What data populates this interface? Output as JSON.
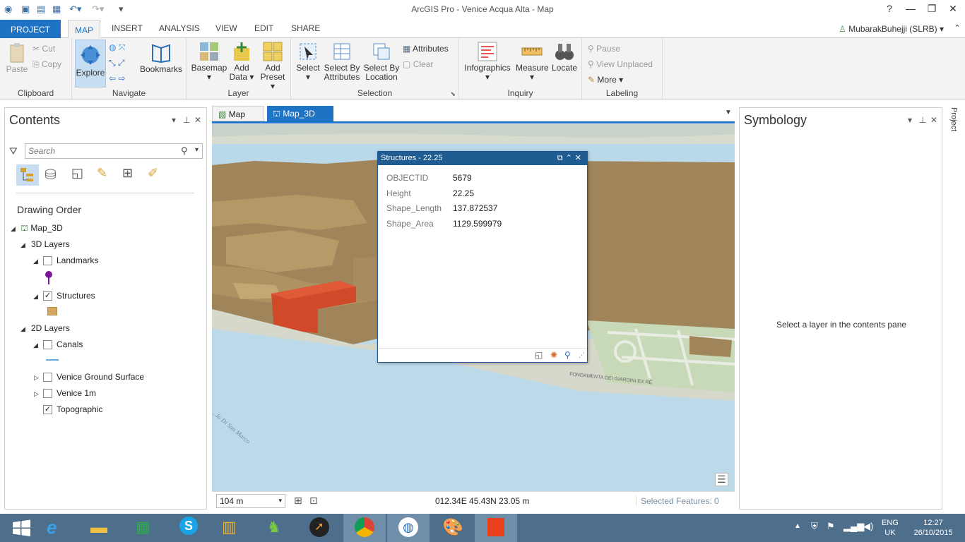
{
  "window": {
    "title": "ArcGIS Pro - Venice Acqua Alta - Map"
  },
  "tabs": [
    "PROJECT",
    "MAP",
    "INSERT",
    "ANALYSIS",
    "VIEW",
    "EDIT",
    "SHARE"
  ],
  "user": {
    "name": "MubarakBuhejji (SLRB)"
  },
  "ribbon": {
    "clipboard": {
      "label": "Clipboard",
      "paste": "Paste",
      "cut": "Cut",
      "copy": "Copy"
    },
    "navigate": {
      "label": "Navigate",
      "explore": "Explore",
      "bookmarks": "Bookmarks"
    },
    "layer": {
      "label": "Layer",
      "basemap": "Basemap",
      "add_data_1": "Add",
      "add_data_2": "Data",
      "add_preset_1": "Add",
      "add_preset_2": "Preset"
    },
    "selection": {
      "label": "Selection",
      "select": "Select",
      "select_by_attr_1": "Select By",
      "select_by_attr_2": "Attributes",
      "select_by_loc_1": "Select By",
      "select_by_loc_2": "Location",
      "attributes": "Attributes",
      "clear": "Clear"
    },
    "inquiry": {
      "label": "Inquiry",
      "infographics": "Infographics",
      "measure": "Measure",
      "locate": "Locate"
    },
    "labeling": {
      "label": "Labeling",
      "pause": "Pause",
      "view_unplaced": "View Unplaced",
      "more": "More"
    }
  },
  "contents": {
    "title": "Contents",
    "search_placeholder": "Search",
    "drawing_order": "Drawing Order",
    "map_name": "Map_3D",
    "group_3d": "3D Layers",
    "landmarks": "Landmarks",
    "structures": "Structures",
    "group_2d": "2D Layers",
    "canals": "Canals",
    "venice_ground": "Venice Ground Surface",
    "venice_1m": "Venice 1m",
    "topographic": "Topographic"
  },
  "views": {
    "map_tab": "Map",
    "map3d_tab": "Map_3D"
  },
  "popup": {
    "title": "Structures - 22.25",
    "fields": [
      {
        "key": "OBJECTID",
        "value": "5679"
      },
      {
        "key": "Height",
        "value": "22.25"
      },
      {
        "key": "Shape_Length",
        "value": "137.872537"
      },
      {
        "key": "Shape_Area",
        "value": "1129.599979"
      }
    ]
  },
  "status": {
    "scale": "104 m",
    "coords": "012.34E 45.43N   23.05 m",
    "selected": "Selected Features: 0"
  },
  "symbology": {
    "title": "Symbology",
    "message": "Select a layer in the contents pane"
  },
  "side_tab": "Project",
  "map_labels": {
    "street_label": "FONDAMENTA DEI GIARDINI EX RE",
    "water_label": "...lo Di San Marco"
  },
  "tray": {
    "lang_1": "ENG",
    "lang_2": "UK",
    "time": "12:27",
    "date": "26/10/2015"
  },
  "colors": {
    "accent": "#1e73c4",
    "building": "#a0855a",
    "selected": "#d04a2a",
    "water": "#b8d6e8"
  }
}
